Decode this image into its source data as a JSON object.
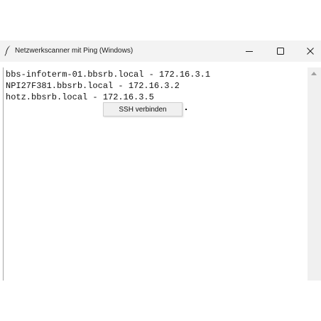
{
  "window": {
    "title": "Netzwerkscanner mit Ping (Windows)",
    "app_icon": "feather-icon",
    "controls": {
      "minimize": "–",
      "maximize": "☐",
      "close": "✕"
    }
  },
  "results": {
    "lines": [
      "bbs-infoterm-01.bbsrb.local - 172.16.3.1",
      "NPI27F381.bbsrb.local - 172.16.3.2",
      "hotz.bbsrb.local - 172.16.3.5"
    ]
  },
  "context_menu": {
    "items": [
      {
        "label": "SSH verbinden"
      }
    ]
  },
  "scrollbar": {
    "up_icon": "scroll-up-arrow-icon"
  }
}
